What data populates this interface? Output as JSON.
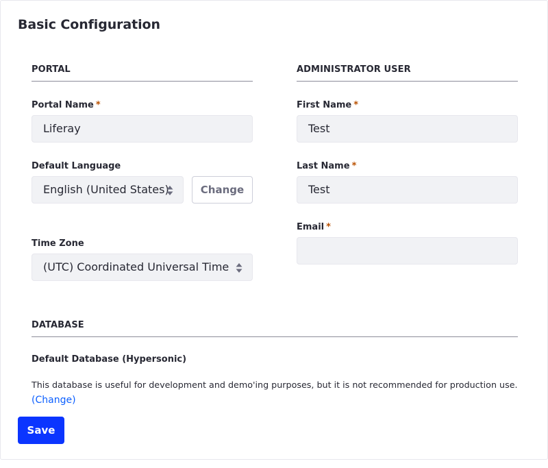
{
  "page": {
    "title": "Basic Configuration"
  },
  "portal": {
    "section_title": "PORTAL",
    "portal_name": {
      "label": "Portal Name",
      "required": "*",
      "value": "Liferay"
    },
    "default_language": {
      "label": "Default Language",
      "value": "English (United States)",
      "change_label": "Change"
    },
    "time_zone": {
      "label": "Time Zone",
      "value": "(UTC) Coordinated Universal Time"
    }
  },
  "admin": {
    "section_title": "ADMINISTRATOR USER",
    "first_name": {
      "label": "First Name",
      "required": "*",
      "value": "Test"
    },
    "last_name": {
      "label": "Last Name",
      "required": "*",
      "value": "Test"
    },
    "email": {
      "label": "Email",
      "required": "*",
      "value": ""
    }
  },
  "database": {
    "section_title": "DATABASE",
    "title": "Default Database (Hypersonic)",
    "description": "This database is useful for development and demo'ing purposes, but it is not recommended for production use.",
    "change_link": "(Change)"
  },
  "actions": {
    "save_label": "Save"
  },
  "colors": {
    "primary": "#0b35ff",
    "link": "#0b5fff",
    "required": "#b95000",
    "field_bg": "#f1f2f5"
  },
  "icons": {
    "select_arrows": "select-arrows-icon"
  }
}
